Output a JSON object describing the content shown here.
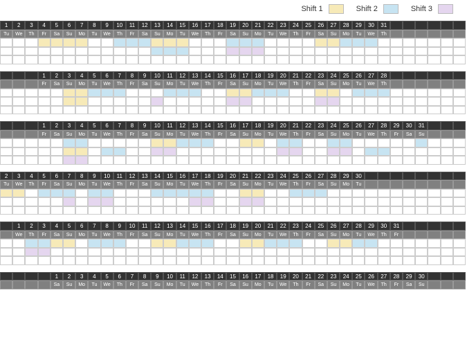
{
  "legend": {
    "s1": "Shift 1",
    "s2": "Shift 2",
    "s3": "Shift 3"
  },
  "colors": {
    "s1": "#f7eab8",
    "s2": "#c7e4f2",
    "s3": "#e5d6ef"
  },
  "blocks": [
    {
      "padLeft": 0,
      "days": 31,
      "dow": [
        "Tu",
        "We",
        "Th",
        "Fr",
        "Sa",
        "Su",
        "Mo",
        "Tu",
        "We",
        "Th",
        "Fr",
        "Sa",
        "Su",
        "Mo",
        "Tu",
        "We",
        "Th",
        "Fr",
        "Sa",
        "Su",
        "Mo",
        "Tu",
        "We",
        "Th",
        "Fr",
        "Sa",
        "Su",
        "Mo",
        "Tu",
        "We",
        "Th"
      ],
      "rows": [
        [
          0,
          0,
          0,
          1,
          1,
          1,
          1,
          0,
          0,
          2,
          2,
          2,
          1,
          1,
          1,
          0,
          0,
          0,
          2,
          2,
          2,
          0,
          0,
          0,
          0,
          1,
          1,
          2,
          2,
          2,
          0
        ],
        [
          0,
          0,
          0,
          0,
          0,
          0,
          0,
          0,
          0,
          0,
          0,
          0,
          2,
          2,
          2,
          0,
          0,
          0,
          3,
          3,
          3,
          0,
          0,
          0,
          0,
          0,
          0,
          0,
          0,
          0,
          0
        ],
        [
          0,
          0,
          0,
          0,
          0,
          0,
          0,
          0,
          0,
          0,
          0,
          0,
          0,
          0,
          0,
          0,
          0,
          0,
          0,
          0,
          0,
          0,
          0,
          0,
          0,
          0,
          0,
          0,
          0,
          0,
          0
        ]
      ]
    },
    {
      "padLeft": 3,
      "days": 28,
      "dow": [
        "Fr",
        "Sa",
        "Su",
        "Mo",
        "Tu",
        "We",
        "Th",
        "Fr",
        "Sa",
        "Su",
        "Mo",
        "Tu",
        "We",
        "Th",
        "Fr",
        "Sa",
        "Su",
        "Mo",
        "Tu",
        "We",
        "Th",
        "Fr",
        "Sa",
        "Su",
        "Mo",
        "Tu",
        "We",
        "Th"
      ],
      "rows": [
        [
          0,
          0,
          1,
          1,
          2,
          2,
          2,
          0,
          0,
          0,
          2,
          2,
          2,
          0,
          0,
          1,
          1,
          2,
          2,
          2,
          0,
          0,
          1,
          1,
          0,
          2,
          2,
          2
        ],
        [
          0,
          0,
          1,
          1,
          0,
          0,
          0,
          0,
          0,
          3,
          0,
          0,
          0,
          0,
          0,
          3,
          3,
          0,
          0,
          0,
          0,
          0,
          3,
          3,
          0,
          0,
          0,
          0
        ],
        [
          0,
          0,
          0,
          0,
          0,
          0,
          0,
          0,
          0,
          0,
          0,
          0,
          0,
          0,
          0,
          0,
          0,
          0,
          0,
          0,
          0,
          0,
          0,
          0,
          0,
          0,
          0,
          0
        ]
      ]
    },
    {
      "padLeft": 3,
      "days": 31,
      "dow": [
        "Fr",
        "Sa",
        "Su",
        "Mo",
        "Tu",
        "We",
        "Th",
        "Fr",
        "Sa",
        "Su",
        "Mo",
        "Tu",
        "We",
        "Th",
        "Fr",
        "Sa",
        "Su",
        "Mo",
        "Tu",
        "We",
        "Th",
        "Fr",
        "Sa",
        "Su",
        "Mo",
        "Tu",
        "We",
        "Th",
        "Fr",
        "Sa",
        "Su"
      ],
      "rows": [
        [
          0,
          0,
          2,
          2,
          0,
          0,
          0,
          0,
          0,
          1,
          1,
          2,
          2,
          2,
          0,
          0,
          1,
          1,
          0,
          2,
          2,
          0,
          0,
          2,
          2,
          0,
          0,
          0,
          0,
          0,
          2
        ],
        [
          0,
          0,
          1,
          1,
          0,
          2,
          2,
          0,
          0,
          3,
          3,
          0,
          0,
          0,
          0,
          0,
          0,
          0,
          0,
          3,
          3,
          0,
          0,
          3,
          3,
          0,
          2,
          2,
          0,
          0,
          0
        ],
        [
          0,
          0,
          3,
          3,
          0,
          0,
          0,
          0,
          0,
          0,
          0,
          0,
          0,
          0,
          0,
          0,
          0,
          0,
          0,
          0,
          0,
          0,
          0,
          0,
          0,
          0,
          0,
          0,
          0,
          0,
          0
        ]
      ]
    },
    {
      "padLeft": 0,
      "startNum": 2,
      "days": 29,
      "dow": [
        "Tu",
        "We",
        "Th",
        "Fr",
        "Sa",
        "Su",
        "Mo",
        "Tu",
        "We",
        "Th",
        "Fr",
        "Sa",
        "Su",
        "Mo",
        "Tu",
        "We",
        "Th",
        "Fr",
        "Sa",
        "Su",
        "Mo",
        "Tu",
        "We",
        "Th",
        "Fr",
        "Sa",
        "Su",
        "Mo",
        "Tu"
      ],
      "rows": [
        [
          1,
          1,
          0,
          2,
          2,
          2,
          0,
          2,
          2,
          0,
          0,
          0,
          2,
          2,
          2,
          2,
          2,
          0,
          0,
          1,
          1,
          0,
          0,
          2,
          2,
          2,
          0,
          0,
          0
        ],
        [
          0,
          0,
          0,
          0,
          0,
          3,
          0,
          3,
          3,
          0,
          0,
          0,
          0,
          0,
          0,
          3,
          3,
          0,
          0,
          3,
          3,
          0,
          0,
          0,
          0,
          0,
          0,
          0,
          0
        ],
        [
          0,
          0,
          0,
          0,
          0,
          0,
          0,
          0,
          0,
          0,
          0,
          0,
          0,
          0,
          0,
          0,
          0,
          0,
          0,
          0,
          0,
          0,
          0,
          0,
          0,
          0,
          0,
          0,
          0
        ]
      ]
    },
    {
      "padLeft": 1,
      "days": 31,
      "dow": [
        "We",
        "Th",
        "Fr",
        "Sa",
        "Su",
        "Mo",
        "Tu",
        "We",
        "Th",
        "Fr",
        "Sa",
        "Su",
        "Mo",
        "Tu",
        "We",
        "Th",
        "Fr",
        "Sa",
        "Su",
        "Mo",
        "Tu",
        "We",
        "Th",
        "Fr",
        "Sa",
        "Su",
        "Mo",
        "Tu",
        "We",
        "Th",
        "Fr"
      ],
      "rows": [
        [
          0,
          2,
          2,
          1,
          1,
          0,
          2,
          2,
          2,
          0,
          0,
          1,
          1,
          2,
          2,
          2,
          0,
          0,
          1,
          1,
          2,
          2,
          2,
          0,
          0,
          1,
          1,
          2,
          2,
          0,
          0
        ],
        [
          0,
          3,
          3,
          0,
          0,
          0,
          0,
          0,
          0,
          0,
          0,
          0,
          0,
          0,
          0,
          0,
          0,
          0,
          0,
          0,
          0,
          0,
          0,
          0,
          0,
          0,
          0,
          0,
          0,
          0,
          0
        ],
        [
          0,
          0,
          0,
          0,
          0,
          0,
          0,
          0,
          0,
          0,
          0,
          0,
          0,
          0,
          0,
          0,
          0,
          0,
          0,
          0,
          0,
          0,
          0,
          0,
          0,
          0,
          0,
          0,
          0,
          0,
          0
        ]
      ]
    },
    {
      "padLeft": 4,
      "days": 30,
      "dow": [
        "Sa",
        "Su",
        "Mo",
        "Tu",
        "We",
        "Th",
        "Fr",
        "Sa",
        "Su",
        "Mo",
        "Tu",
        "We",
        "Th",
        "Fr",
        "Sa",
        "Su",
        "Mo",
        "Tu",
        "We",
        "Th",
        "Fr",
        "Sa",
        "Su",
        "Mo",
        "Tu",
        "We",
        "Th",
        "Fr",
        "Sa",
        "Su"
      ],
      "rows": []
    }
  ]
}
